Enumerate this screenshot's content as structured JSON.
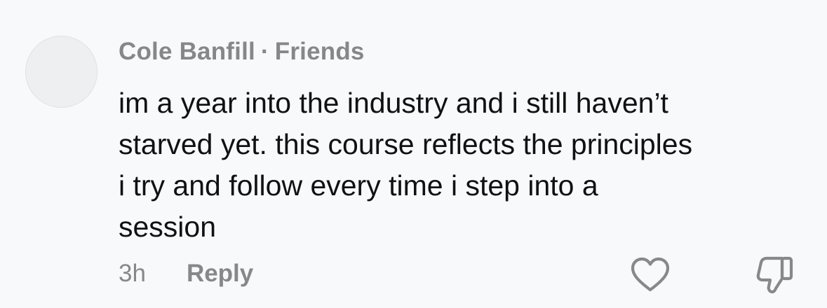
{
  "comment": {
    "author": "Cole Banfill",
    "separator": "·",
    "relationship": "Friends",
    "text_lines": [
      "im a year into the industry and i still haven’t",
      "starved yet. this course reflects the principles",
      "i try and follow every time i step into a",
      "session"
    ],
    "timestamp": "3h",
    "reply_label": "Reply",
    "icons": {
      "avatar": "avatar-placeholder",
      "like": "heart-icon",
      "dislike": "thumbs-down-icon"
    },
    "colors": {
      "background": "#f8f9fb",
      "meta_text": "#85878b",
      "body_text": "#111111",
      "icon_stroke": "#86888c"
    }
  }
}
